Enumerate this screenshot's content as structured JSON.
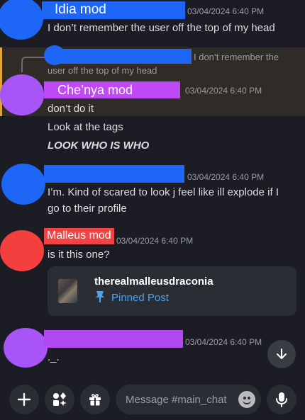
{
  "messages": [
    {
      "author": "Idia mod",
      "author_color": "#3b82f6",
      "avatar_color": "#1e66f5",
      "timestamp": "03/04/2024 6:40 PM",
      "lines": [
        "I don’t remember the user off the top of my head"
      ]
    },
    {
      "reply_to": {
        "text_line1": "I don’t remember the",
        "text_line2": "user off the top of my head"
      },
      "author": "Che’nya mod",
      "author_color": "#c04af6",
      "avatar_color": "#a855f7",
      "timestamp": "03/04/2024 6:40 PM",
      "lines": [
        "don’t do it",
        "Look at the tags",
        "LOOK WHO IS WHO"
      ]
    },
    {
      "author": "",
      "author_color": "#3b82f6",
      "avatar_color": "#1e66f5",
      "timestamp": "03/04/2024 6:40 PM",
      "lines": [
        "I’m. Kind of scared to look j feel like ill explode if I",
        "go to their profile"
      ]
    },
    {
      "author": "Malleus mod",
      "author_color": "#ef4444",
      "avatar_color": "#f43f3f",
      "timestamp": "03/04/2024 6:40 PM",
      "lines": [
        "is it this one?"
      ],
      "embed": {
        "title": "therealmalleusdraconia",
        "subtitle": "Pinned Post"
      }
    },
    {
      "author": "",
      "author_color": "#b04af0",
      "avatar_color": "#a855f7",
      "timestamp": "03/04/2024 6:40 PM",
      "lines": [
        "._."
      ]
    }
  ],
  "composer": {
    "placeholder": "Message #main_chat",
    "icons": [
      "plus-icon",
      "apps-icon",
      "gift-icon",
      "emoji-icon",
      "microphone-icon"
    ]
  },
  "scroll_icon": "arrow-down-icon"
}
